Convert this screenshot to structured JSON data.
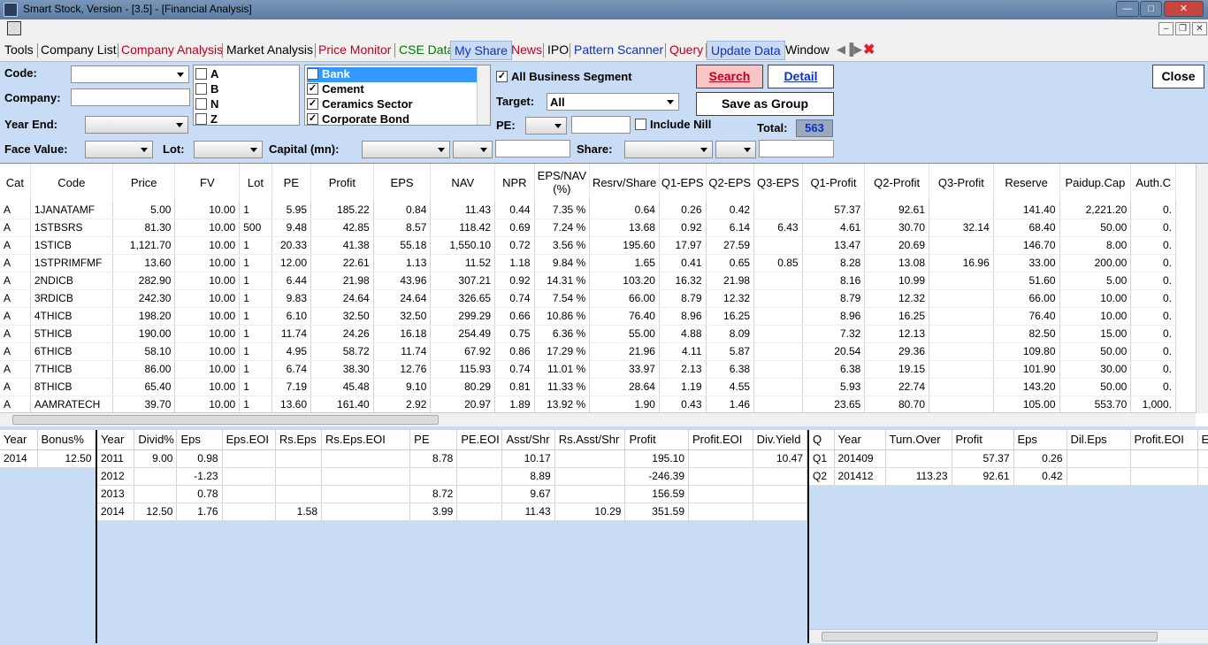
{
  "window": {
    "title": "Smart Stock, Version - [3.5] - [Financial Analysis]",
    "minimize": "—",
    "maximize": "□",
    "close": "✕"
  },
  "mdi": {
    "minimize": "–",
    "restore": "❐",
    "close": "✕"
  },
  "menu": [
    {
      "label": "Tools",
      "color": "#000000"
    },
    {
      "label": "Company List",
      "color": "#000000"
    },
    {
      "label": "Company Analysis",
      "color": "#c0001e"
    },
    {
      "label": "Market Analysis",
      "color": "#000000"
    },
    {
      "label": "Price Monitor",
      "color": "#c0001e"
    },
    {
      "label": "CSE Data",
      "color": "#007a00"
    },
    {
      "label": "My Share",
      "color": "#1030c0"
    },
    {
      "label": "News",
      "color": "#c0001e"
    },
    {
      "label": "IPO",
      "color": "#000000"
    },
    {
      "label": "Pattern Scanner",
      "color": "#1030c0"
    },
    {
      "label": "Query",
      "color": "#c0001e"
    },
    {
      "label": "Update Data",
      "color": "#1030c0"
    },
    {
      "label": "Window",
      "color": "#000000"
    }
  ],
  "filters": {
    "code_label": "Code:",
    "company_label": "Company:",
    "year_end_label": "Year End:",
    "face_value_label": "Face Value:",
    "lot_label": "Lot:",
    "capital_label": "Capital (mn):",
    "share_label": "Share:",
    "categories": [
      {
        "label": "A",
        "checked": false
      },
      {
        "label": "B",
        "checked": false
      },
      {
        "label": "N",
        "checked": false
      },
      {
        "label": "Z",
        "checked": false
      }
    ],
    "sectors": [
      {
        "label": "Bank",
        "checked": true,
        "selected": true
      },
      {
        "label": "Cement",
        "checked": true,
        "selected": false
      },
      {
        "label": "Ceramics Sector",
        "checked": true,
        "selected": false
      },
      {
        "label": "Corporate Bond",
        "checked": true,
        "selected": false
      }
    ],
    "all_business_segment": "All Business Segment",
    "target_label": "Target:",
    "target_value": "All",
    "pe_label": "PE:",
    "include_nill": "Include Nill",
    "total_label": "Total:",
    "total_value": "563",
    "search_button": "Search",
    "detail_button": "Detail",
    "save_group_button": "Save as Group",
    "close_button": "Close"
  },
  "main_table": {
    "columns": [
      "Cat",
      "Code",
      "Price",
      "FV",
      "Lot",
      "PE",
      "Profit",
      "EPS",
      "NAV",
      "NPR",
      "EPS/NAV (%)",
      "Resrv/Share",
      "Q1-EPS",
      "Q2-EPS",
      "Q3-EPS",
      "Q1-Profit",
      "Q2-Profit",
      "Q3-Profit",
      "Reserve",
      "Paidup.Cap",
      "Auth.C"
    ],
    "rows": [
      [
        "A",
        "1JANATAMF",
        "5.00",
        "10.00",
        "1",
        "5.95",
        "185.22",
        "0.84",
        "11.43",
        "0.44",
        "7.35 %",
        "0.64",
        "0.26",
        "0.42",
        "",
        "57.37",
        "92.61",
        "",
        "141.40",
        "2,221.20",
        "0."
      ],
      [
        "A",
        "1STBSRS",
        "81.30",
        "10.00",
        "500",
        "9.48",
        "42.85",
        "8.57",
        "118.42",
        "0.69",
        "7.24 %",
        "13.68",
        "0.92",
        "6.14",
        "6.43",
        "4.61",
        "30.70",
        "32.14",
        "68.40",
        "50.00",
        "0."
      ],
      [
        "A",
        "1STICB",
        "1,121.70",
        "10.00",
        "1",
        "20.33",
        "41.38",
        "55.18",
        "1,550.10",
        "0.72",
        "3.56 %",
        "195.60",
        "17.97",
        "27.59",
        "",
        "13.47",
        "20.69",
        "",
        "146.70",
        "8.00",
        "0."
      ],
      [
        "A",
        "1STPRIMFMF",
        "13.60",
        "10.00",
        "1",
        "12.00",
        "22.61",
        "1.13",
        "11.52",
        "1.18",
        "9.84 %",
        "1.65",
        "0.41",
        "0.65",
        "0.85",
        "8.28",
        "13.08",
        "16.96",
        "33.00",
        "200.00",
        "0."
      ],
      [
        "A",
        "2NDICB",
        "282.90",
        "10.00",
        "1",
        "6.44",
        "21.98",
        "43.96",
        "307.21",
        "0.92",
        "14.31 %",
        "103.20",
        "16.32",
        "21.98",
        "",
        "8.16",
        "10.99",
        "",
        "51.60",
        "5.00",
        "0."
      ],
      [
        "A",
        "3RDICB",
        "242.30",
        "10.00",
        "1",
        "9.83",
        "24.64",
        "24.64",
        "326.65",
        "0.74",
        "7.54 %",
        "66.00",
        "8.79",
        "12.32",
        "",
        "8.79",
        "12.32",
        "",
        "66.00",
        "10.00",
        "0."
      ],
      [
        "A",
        "4THICB",
        "198.20",
        "10.00",
        "1",
        "6.10",
        "32.50",
        "32.50",
        "299.29",
        "0.66",
        "10.86 %",
        "76.40",
        "8.96",
        "16.25",
        "",
        "8.96",
        "16.25",
        "",
        "76.40",
        "10.00",
        "0."
      ],
      [
        "A",
        "5THICB",
        "190.00",
        "10.00",
        "1",
        "11.74",
        "24.26",
        "16.18",
        "254.49",
        "0.75",
        "6.36 %",
        "55.00",
        "4.88",
        "8.09",
        "",
        "7.32",
        "12.13",
        "",
        "82.50",
        "15.00",
        "0."
      ],
      [
        "A",
        "6THICB",
        "58.10",
        "10.00",
        "1",
        "4.95",
        "58.72",
        "11.74",
        "67.92",
        "0.86",
        "17.29 %",
        "21.96",
        "4.11",
        "5.87",
        "",
        "20.54",
        "29.36",
        "",
        "109.80",
        "50.00",
        "0."
      ],
      [
        "A",
        "7THICB",
        "86.00",
        "10.00",
        "1",
        "6.74",
        "38.30",
        "12.76",
        "115.93",
        "0.74",
        "11.01 %",
        "33.97",
        "2.13",
        "6.38",
        "",
        "6.38",
        "19.15",
        "",
        "101.90",
        "30.00",
        "0."
      ],
      [
        "A",
        "8THICB",
        "65.40",
        "10.00",
        "1",
        "7.19",
        "45.48",
        "9.10",
        "80.29",
        "0.81",
        "11.33 %",
        "28.64",
        "1.19",
        "4.55",
        "",
        "5.93",
        "22.74",
        "",
        "143.20",
        "50.00",
        "0."
      ],
      [
        "A",
        "AAMRATECH",
        "39.70",
        "10.00",
        "1",
        "13.60",
        "161.40",
        "2.92",
        "20.97",
        "1.89",
        "13.92 %",
        "1.90",
        "0.43",
        "1.46",
        "",
        "23.65",
        "80.70",
        "",
        "105.00",
        "553.70",
        "1,000."
      ]
    ]
  },
  "bonus_table": {
    "columns": [
      "Year",
      "Bonus%"
    ],
    "rows": [
      [
        "2014",
        "12.50"
      ]
    ]
  },
  "yearly_table": {
    "columns": [
      "Year",
      "Divid%",
      "Eps",
      "Eps.EOI",
      "Rs.Eps",
      "Rs.Eps.EOI",
      "PE",
      "PE.EOI",
      "Asst/Shr",
      "Rs.Asst/Shr",
      "Profit",
      "Profit.EOI",
      "Div.Yield"
    ],
    "rows": [
      [
        "2011",
        "9.00",
        "0.98",
        "",
        "",
        "",
        "8.78",
        "",
        "10.17",
        "",
        "195.10",
        "",
        "10.47"
      ],
      [
        "2012",
        "",
        "-1.23",
        "",
        "",
        "",
        "",
        "",
        "8.89",
        "",
        "-246.39",
        "",
        ""
      ],
      [
        "2013",
        "",
        "0.78",
        "",
        "",
        "",
        "8.72",
        "",
        "9.67",
        "",
        "156.59",
        "",
        ""
      ],
      [
        "2014",
        "12.50",
        "1.76",
        "",
        "1.58",
        "",
        "3.99",
        "",
        "11.43",
        "10.29",
        "351.59",
        "",
        ""
      ]
    ]
  },
  "quarter_table": {
    "columns": [
      "Q",
      "Year",
      "Turn.Over",
      "Profit",
      "Eps",
      "Dil.Eps",
      "Profit.EOI",
      "Eps.E"
    ],
    "rows": [
      [
        "Q1",
        "201409",
        "",
        "57.37",
        "0.26",
        "",
        "",
        ""
      ],
      [
        "Q2",
        "201412",
        "113.23",
        "92.61",
        "0.42",
        "",
        "",
        ""
      ]
    ]
  }
}
